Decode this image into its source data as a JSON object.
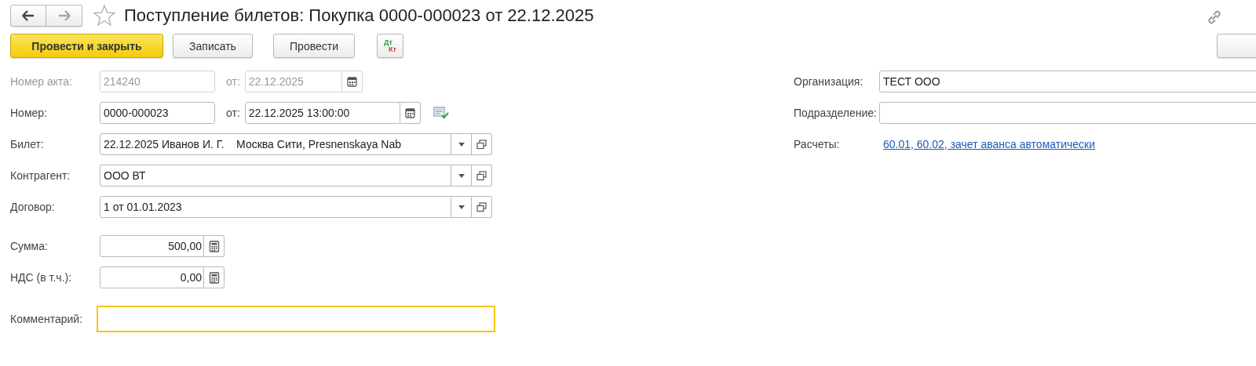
{
  "window": {
    "title": "Поступление билетов: Покупка 0000-000023 от 22.12.2025"
  },
  "nav": [
    {
      "kind": "back",
      "disabled": false
    },
    {
      "kind": "forward",
      "disabled": true
    }
  ],
  "toolbar": [
    {
      "kind": "button",
      "label": "Провести и закрыть",
      "default": true
    },
    {
      "kind": "button",
      "label": "Записать",
      "default": false
    },
    {
      "kind": "button",
      "label": "Провести",
      "default": false
    },
    {
      "kind": "dtkt",
      "top": "Дт",
      "bottom": "Кт"
    }
  ],
  "left_fields": [
    {
      "kind": "number_date",
      "label": "Номер акта:",
      "value": "214240",
      "date_label": "от:",
      "date": "22.12.2025",
      "disabled": true
    },
    {
      "kind": "number_datetime",
      "label": "Номер:",
      "value": "0000-000023",
      "date_label": "от:",
      "date": "22.12.2025 13:00:00",
      "disabled": false
    },
    {
      "kind": "select",
      "label": "Билет:",
      "value": "22.12.2025 Иванов И. Г.    Москва Сити, Presnenskaya Nab"
    },
    {
      "kind": "select",
      "label": "Контрагент:",
      "value": "ООО ВТ"
    },
    {
      "kind": "select",
      "label": "Договор:",
      "value": "1 от 01.01.2023"
    },
    {
      "kind": "amount",
      "label": "Сумма:",
      "value": "500,00"
    },
    {
      "kind": "amount",
      "label": "НДС (в т.ч.):",
      "value": "0,00"
    },
    {
      "kind": "text",
      "label": "Комментарий:",
      "focused": true
    }
  ],
  "right_fields": [
    {
      "kind": "text",
      "label": "Организация:",
      "value": "ТЕСТ ООО"
    },
    {
      "kind": "text",
      "label": "Подразделение:"
    },
    {
      "kind": "link",
      "label": "Расчеты:",
      "value": "60.01, 60.02, зачет аванса автоматически"
    }
  ]
}
